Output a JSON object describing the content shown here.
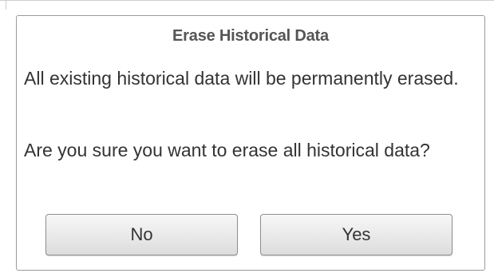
{
  "dialog": {
    "title": "Erase Historical Data",
    "message": "All existing historical data will be permanently erased.",
    "question": "Are you sure you want to erase all historical data?",
    "buttons": {
      "no_label": "No",
      "yes_label": "Yes"
    }
  }
}
